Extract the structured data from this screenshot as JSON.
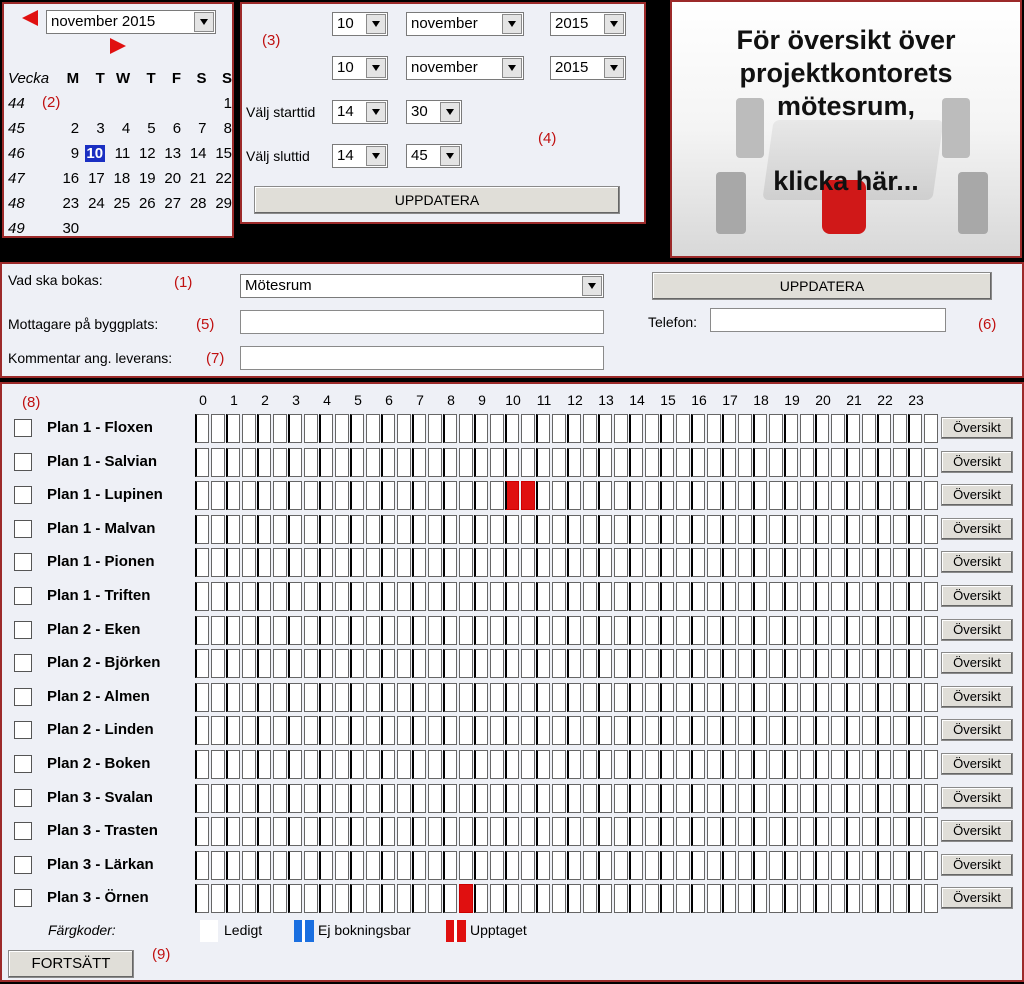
{
  "calendar": {
    "month_select": "november 2015",
    "headers": [
      "Vecka",
      "M",
      "T",
      "W",
      "T",
      "F",
      "S",
      "S"
    ],
    "weeks": [
      {
        "wk": "44",
        "days": [
          "",
          "",
          "",
          "",
          "",
          "",
          "1"
        ]
      },
      {
        "wk": "45",
        "days": [
          "2",
          "3",
          "4",
          "5",
          "6",
          "7",
          "8"
        ]
      },
      {
        "wk": "46",
        "days": [
          "9",
          "10",
          "11",
          "12",
          "13",
          "14",
          "15"
        ]
      },
      {
        "wk": "47",
        "days": [
          "16",
          "17",
          "18",
          "19",
          "20",
          "21",
          "22"
        ]
      },
      {
        "wk": "48",
        "days": [
          "23",
          "24",
          "25",
          "26",
          "27",
          "28",
          "29"
        ]
      },
      {
        "wk": "49",
        "days": [
          "30",
          "",
          "",
          "",
          "",
          "",
          ""
        ]
      }
    ],
    "today": "10",
    "note": "(2)"
  },
  "date_panel": {
    "note3": "(3)",
    "note4": "(4)",
    "start_day": "10",
    "start_month": "november",
    "start_year": "2015",
    "end_day": "10",
    "end_month": "november",
    "end_year": "2015",
    "start_label": "Välj starttid",
    "start_hour": "14",
    "start_min": "30",
    "end_label": "Välj sluttid",
    "end_hour": "14",
    "end_min": "45",
    "update": "UPPDATERA"
  },
  "promo": {
    "line1": "För översikt över",
    "line2": "projektkontorets",
    "line3": "mötesrum,",
    "line4": "klicka här..."
  },
  "form": {
    "what_label": "Vad ska bokas:",
    "note1": "(1)",
    "what_value": "Mötesrum",
    "recv_label": "Mottagare på byggplats:",
    "note5": "(5)",
    "comment_label": "Kommentar ang. leverans:",
    "note7": "(7)",
    "phone_label": "Telefon:",
    "note6": "(6)",
    "update": "UPPDATERA"
  },
  "schedule": {
    "note8": "(8)",
    "hours": [
      "0",
      "1",
      "2",
      "3",
      "4",
      "5",
      "6",
      "7",
      "8",
      "9",
      "10",
      "11",
      "12",
      "13",
      "14",
      "15",
      "16",
      "17",
      "18",
      "19",
      "20",
      "21",
      "22",
      "23"
    ],
    "rooms": [
      {
        "name": "Plan 1 - Floxen",
        "busy": []
      },
      {
        "name": "Plan 1 - Salvian",
        "busy": []
      },
      {
        "name": "Plan 1 - Lupinen",
        "busy": [
          20,
          21
        ]
      },
      {
        "name": "Plan 1 - Malvan",
        "busy": []
      },
      {
        "name": "Plan 1 - Pionen",
        "busy": []
      },
      {
        "name": "Plan 1 - Triften",
        "busy": []
      },
      {
        "name": "Plan 2 - Eken",
        "busy": []
      },
      {
        "name": "Plan 2 - Björken",
        "busy": []
      },
      {
        "name": "Plan 2 - Almen",
        "busy": []
      },
      {
        "name": "Plan 2 - Linden",
        "busy": []
      },
      {
        "name": "Plan 2 - Boken",
        "busy": []
      },
      {
        "name": "Plan 3 - Svalan",
        "busy": []
      },
      {
        "name": "Plan 3 - Trasten",
        "busy": []
      },
      {
        "name": "Plan 3 - Lärkan",
        "busy": []
      },
      {
        "name": "Plan 3 - Örnen",
        "busy": [
          17
        ]
      }
    ],
    "overview": "Översikt",
    "legend_title": "Färgkoder:",
    "legend_free": "Ledigt",
    "legend_unbookable": "Ej bokningsbar",
    "legend_busy": "Upptaget",
    "continue": "FORTSÄTT",
    "note9": "(9)",
    "colors": {
      "free": "#ffffff",
      "unbookable": "#1a6fe0",
      "busy": "#e01010"
    }
  }
}
